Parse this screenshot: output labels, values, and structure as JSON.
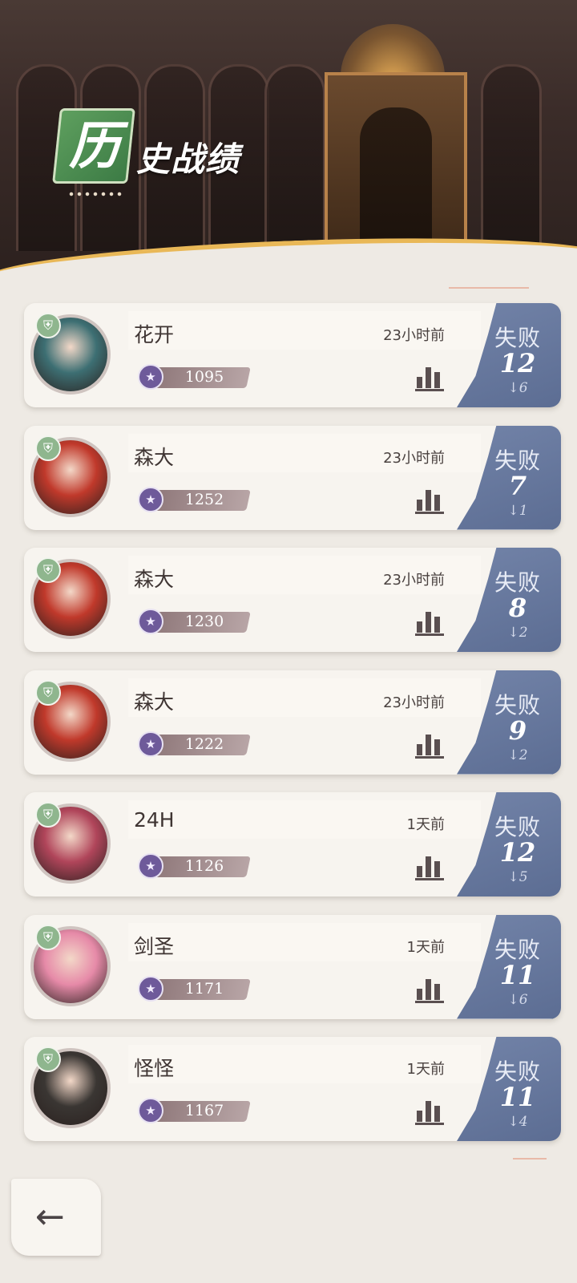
{
  "page": {
    "title_first_char": "历",
    "title_rest": "史战绩"
  },
  "history": [
    {
      "name": "花开",
      "time": "23小时前",
      "score": "1095",
      "result": "失败",
      "value": "12",
      "change": "↓6",
      "avatar_color": "#3d6f73"
    },
    {
      "name": "森大",
      "time": "23小时前",
      "score": "1252",
      "result": "失败",
      "value": "7",
      "change": "↓1",
      "avatar_color": "#c0392b"
    },
    {
      "name": "森大",
      "time": "23小时前",
      "score": "1230",
      "result": "失败",
      "value": "8",
      "change": "↓2",
      "avatar_color": "#c0392b"
    },
    {
      "name": "森大",
      "time": "23小时前",
      "score": "1222",
      "result": "失败",
      "value": "9",
      "change": "↓2",
      "avatar_color": "#c0392b"
    },
    {
      "name": "24H",
      "time": "1天前",
      "score": "1126",
      "result": "失败",
      "value": "12",
      "change": "↓5",
      "avatar_color": "#b0455a"
    },
    {
      "name": "剑圣",
      "time": "1天前",
      "score": "1171",
      "result": "失败",
      "value": "11",
      "change": "↓6",
      "avatar_color": "#e68aa8"
    },
    {
      "name": "怪怪",
      "time": "1天前",
      "score": "1167",
      "result": "失败",
      "value": "11",
      "change": "↓4",
      "avatar_color": "#3a3633"
    }
  ],
  "icons": {
    "back": "back-arrow-icon",
    "stats": "bar-chart-icon",
    "shield": "shield-icon",
    "trophy": "trophy-icon"
  }
}
